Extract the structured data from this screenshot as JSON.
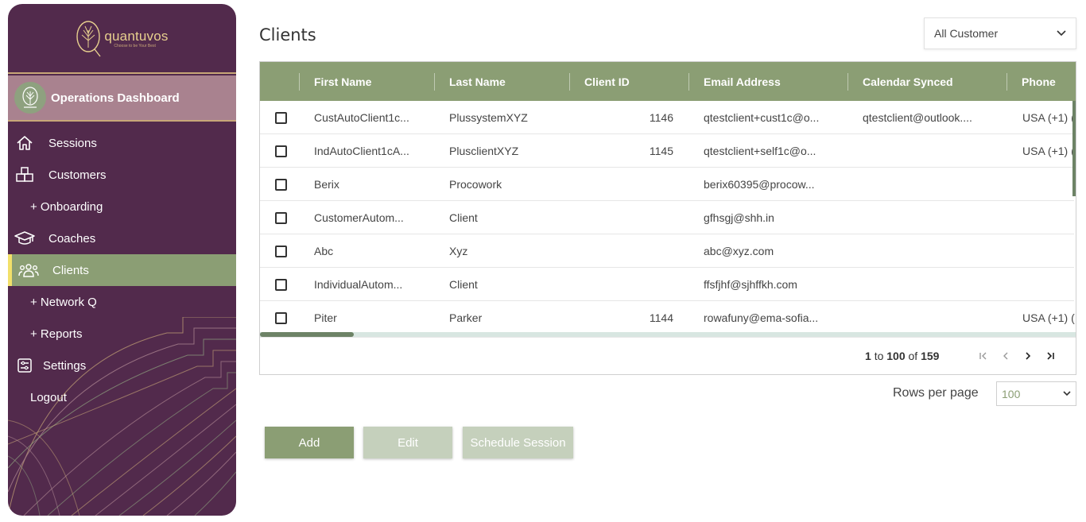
{
  "brand": {
    "name": "quantuvos",
    "tagline": "Choose to be Your Best"
  },
  "sidebar": {
    "dashboard_label": "Operations Dashboard",
    "items": [
      {
        "label": "Sessions",
        "icon": "home-icon"
      },
      {
        "label": "Customers",
        "icon": "boxes-icon"
      },
      {
        "label": "+ Onboarding"
      },
      {
        "label": "Coaches",
        "icon": "graduation-cap-icon"
      },
      {
        "label": "Clients",
        "icon": "users-icon",
        "active": true
      },
      {
        "label": "+ Network Q"
      },
      {
        "label": "+ Reports"
      },
      {
        "label": "Settings",
        "icon": "settings-panel-icon"
      },
      {
        "label": "Logout"
      }
    ]
  },
  "page": {
    "title": "Clients"
  },
  "filter": {
    "selected": "All Customer"
  },
  "grid": {
    "columns": [
      "First Name",
      "Last Name",
      "Client ID",
      "Email Address",
      "Calendar Synced",
      "Phone"
    ],
    "rows": [
      {
        "first": "CustAutoClient1c...",
        "last": "PlussystemXYZ",
        "id": "1146",
        "email": "qtestclient+cust1c@o...",
        "calendar": "qtestclient@outlook....",
        "phone": "USA (+1) ("
      },
      {
        "first": "IndAutoClient1cA...",
        "last": "PlusclientXYZ",
        "id": "1145",
        "email": "qtestclient+self1c@o...",
        "calendar": "",
        "phone": "USA (+1) ("
      },
      {
        "first": "Berix",
        "last": "Procowork",
        "id": "",
        "email": "berix60395@procow...",
        "calendar": "",
        "phone": ""
      },
      {
        "first": "CustomerAutom...",
        "last": "Client",
        "id": "",
        "email": "gfhsgj@shh.in",
        "calendar": "",
        "phone": ""
      },
      {
        "first": "Abc",
        "last": "Xyz",
        "id": "",
        "email": "abc@xyz.com",
        "calendar": "",
        "phone": ""
      },
      {
        "first": "IndividualAutom...",
        "last": "Client",
        "id": "",
        "email": "ffsfjhf@sjhffkh.com",
        "calendar": "",
        "phone": ""
      },
      {
        "first": "Piter",
        "last": "Parker",
        "id": "1144",
        "email": "rowafuny@ema-sofia...",
        "calendar": "",
        "phone": "USA (+1) ("
      }
    ],
    "pager": {
      "from": "1",
      "to_word": "to",
      "to": "100",
      "of_word": "of",
      "total": "159"
    }
  },
  "rows_per_page": {
    "label": "Rows per page",
    "value": "100"
  },
  "actions": {
    "add": "Add",
    "edit": "Edit",
    "schedule": "Schedule Session"
  },
  "colors": {
    "sidebar": "#522a4c",
    "accent": "#8b9e74",
    "active_bar": "#f2e06a",
    "disabled": "#c5d0bc"
  }
}
